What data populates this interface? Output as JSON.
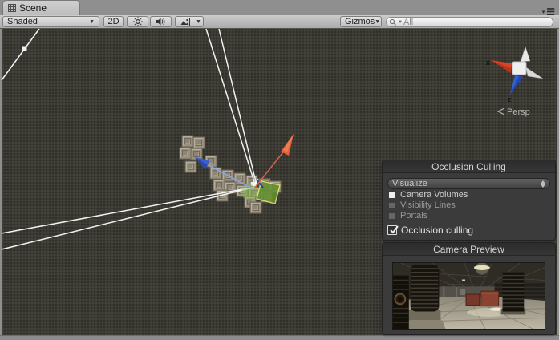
{
  "window": {
    "tab_title": "Scene"
  },
  "toolbar": {
    "shading_dropdown": "Shaded",
    "toggle_2d": "2D",
    "gizmos_dropdown": "Gizmos",
    "search_placeholder": "All"
  },
  "scene_gizmo": {
    "axis_x": "x",
    "axis_z": "z",
    "projection": "Persp"
  },
  "occlusion_panel": {
    "title": "Occlusion Culling",
    "mode_dropdown": "Visualize",
    "options": [
      {
        "label": "Camera Volumes",
        "active": true
      },
      {
        "label": "Visibility Lines",
        "active": false
      },
      {
        "label": "Portals",
        "active": false
      }
    ],
    "toggle": {
      "label": "Occlusion culling",
      "checked": true
    }
  },
  "camera_preview_panel": {
    "title": "Camera Preview"
  },
  "colors": {
    "axis_x_red": "#d8442a",
    "axis_z_blue": "#2f62d8",
    "move_handle_orange": "#e2603a",
    "move_handle_blue": "#3b5fd0",
    "selection_green": "#86b94a",
    "quad_outline_yellow": "#e9e971",
    "frustum_white": "#f2f2f2",
    "scene_background": "#3b3a33"
  }
}
